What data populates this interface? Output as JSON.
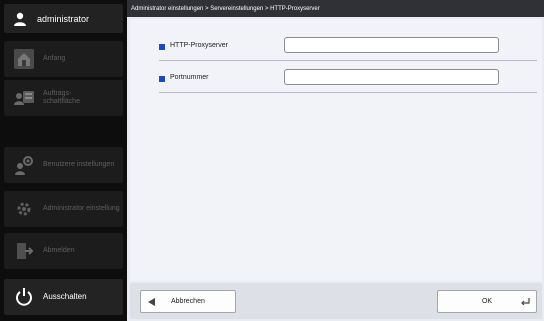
{
  "user": {
    "name": "administrator",
    "icon": "user-icon"
  },
  "sidebar": {
    "items": [
      {
        "label": "Anfang",
        "icon": "home-icon"
      },
      {
        "label": "Auftrags-\nschaltfläche",
        "icon": "job-button-icon"
      },
      {
        "label": "Benutzere instellungen",
        "icon": "user-settings-icon"
      },
      {
        "label": "Administrator einstellung",
        "icon": "admin-settings-icon"
      },
      {
        "label": "Abmelden",
        "icon": "logout-icon"
      }
    ],
    "power": {
      "label": "Ausschalten",
      "icon": "power-icon"
    }
  },
  "breadcrumb": "Administrator einstellungen > Servereinstellungen > HTTP-Proxyserver",
  "form": {
    "fields": [
      {
        "label": "HTTP-Proxyserver",
        "value": ""
      },
      {
        "label": "Portnummer",
        "value": ""
      }
    ]
  },
  "footer": {
    "cancel_label": "Abbrechen",
    "ok_label": "OK"
  },
  "colors": {
    "accent": "#1d4bbf",
    "sidebar": "#0d0d0d",
    "content": "#f1f3f9"
  }
}
